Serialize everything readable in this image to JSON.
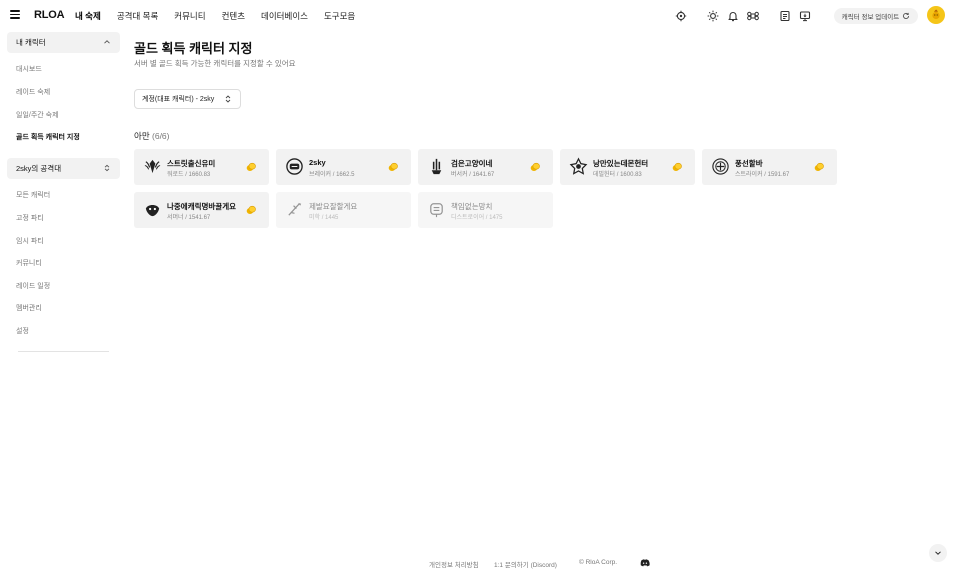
{
  "topbar": {
    "logo": "RLOA",
    "nav": [
      "내 숙제",
      "공격대 목록",
      "커뮤니티",
      "컨텐츠",
      "데이터베이스",
      "도구모음"
    ],
    "active_nav": 0,
    "update_button": "캐릭터 정보 업데이트"
  },
  "sidebar": {
    "group1": {
      "label": "내 캐릭터",
      "items": [
        "대시보드",
        "레이드 숙제",
        "일일/주간 숙제",
        "골드 획득 캐릭터 지정"
      ],
      "active": 3
    },
    "group2": {
      "label": "2sky의 공격대",
      "items": [
        "모든 캐릭터",
        "고정 파티",
        "임시 파티",
        "커뮤니티",
        "레이드 일정",
        "멤버관리",
        "설정"
      ]
    }
  },
  "main": {
    "title": "골드 획득 캐릭터 지정",
    "description": "서버 별 골드 획득 가능한 캐릭터를 지정할 수 있어요",
    "account_select": "계정(대표 캐릭터) - 2sky",
    "server": {
      "name": "아만",
      "count": "(6/6)"
    },
    "characters": [
      {
        "name": "스트릿출신유미",
        "class_level": "워로드 / 1660.83",
        "enabled": true,
        "emblem": "warlord-emblem-icon"
      },
      {
        "name": "2sky",
        "class_level": "브레이커 / 1662.5",
        "enabled": true,
        "emblem": "breaker-emblem-icon"
      },
      {
        "name": "검은고양이네",
        "class_level": "버서커 / 1641.67",
        "enabled": true,
        "emblem": "berserker-emblem-icon"
      },
      {
        "name": "낭만있는데몬헌터",
        "class_level": "데빌헌터 / 1600.83",
        "enabled": true,
        "emblem": "devilhunter-emblem-icon"
      },
      {
        "name": "풍선할바",
        "class_level": "스트라이커 / 1591.67",
        "enabled": true,
        "emblem": "striker-emblem-icon"
      },
      {
        "name": "나중에캐릭명바꿀게요",
        "class_level": "서머너 / 1541.67",
        "enabled": true,
        "emblem": "summoner-emblem-icon"
      },
      {
        "name": "제발요잘할게요",
        "class_level": "미학 / 1445",
        "enabled": false,
        "emblem": "artist-emblem-icon"
      },
      {
        "name": "책임없는망치",
        "class_level": "디스트로이어 / 1475",
        "enabled": false,
        "emblem": "destroyer-emblem-icon"
      }
    ]
  },
  "footer": {
    "privacy": "개인정보 처리방침",
    "contact": "1:1 문의하기 (Discord)",
    "copyright": "© RloA Corp."
  },
  "colors": {
    "gold": "#f0b400",
    "card_bg": "#f2f2f2",
    "avatar": "#f5c518"
  }
}
